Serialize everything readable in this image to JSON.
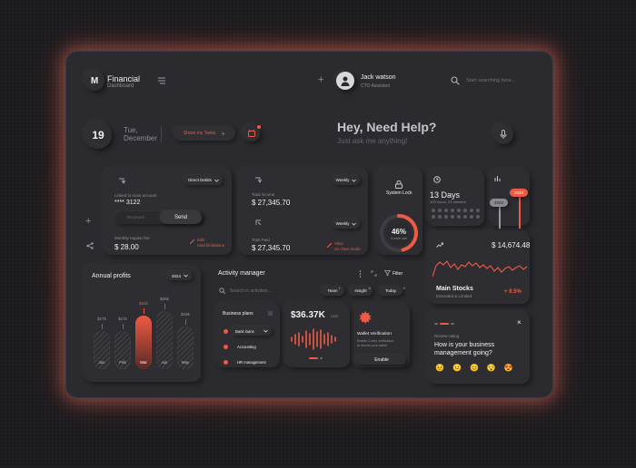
{
  "brand": {
    "title": "Financial",
    "subtitle": "Dashboard",
    "logo_letter": "M"
  },
  "user": {
    "name": "Jack watson",
    "role": "CTO Assistant"
  },
  "search": {
    "placeholder": "Start searching here..."
  },
  "date": {
    "day": "19",
    "weekday": "Tue,",
    "month": "December"
  },
  "share_tasks": {
    "label": "Share my Tasks",
    "plus": "+"
  },
  "help": {
    "title": "Hey, Need Help?",
    "subtitle": "Just ask me anything!"
  },
  "payment": {
    "dropdown": "Direct Debits",
    "linked_label": "Linked to main account",
    "account": "**** 3122",
    "received_label": "Received",
    "send_label": "Send",
    "fee_label": "Monthly regular fee",
    "fee_value": "$ 28.00",
    "edit_label_1": "Edit",
    "edit_label_2": "card limitations"
  },
  "income": {
    "dropdown": "Weekly",
    "total_income_label": "Total income",
    "total_income_value": "$ 27,345.70",
    "dropdown2": "Weekly",
    "total_paid_label": "Total Paid",
    "total_paid_value": "$ 27,345.70",
    "view_label_1": "View",
    "view_label_2": "on chart mode"
  },
  "system_lock": {
    "label": "System Lock",
    "percent": "46%",
    "caption": "Growth rate",
    "progress": 0.46
  },
  "days": {
    "title": "13 Days",
    "subtitle": "109 hours, 23 minutes"
  },
  "years": {
    "a": "2023",
    "b": "2024"
  },
  "stocks": {
    "value": "$ 14,674.48",
    "title": "Main Stocks",
    "subtitle": "Extended & Limited",
    "change": "+ 9.5%"
  },
  "annual_profits": {
    "title": "Annual profits",
    "year": "2024",
    "bars": [
      {
        "month": "Jan",
        "label": "$17k",
        "value": 17
      },
      {
        "month": "Feb",
        "label": "$17k",
        "value": 17
      },
      {
        "month": "Mar",
        "label": "$24k",
        "value": 24
      },
      {
        "month": "Apr",
        "label": "$26k",
        "value": 26
      },
      {
        "month": "May",
        "label": "$19k",
        "value": 19
      }
    ]
  },
  "activity": {
    "title": "Activity manager",
    "filter_label": "Filter",
    "search_placeholder": "Search in activities...",
    "chips": [
      "Team",
      "Insight",
      "Today"
    ],
    "business_title": "Business plans",
    "business_items": [
      "Bank loans",
      "Accounting",
      "HR management"
    ],
    "amount": "$36.37K",
    "amount_currency": "USD"
  },
  "wallet": {
    "title": "Wallet Verification",
    "desc_1": "Enable 2-step verification",
    "desc_2": "to secure your wallet",
    "enable_label": "Enable"
  },
  "review": {
    "label": "Review rating",
    "question_1": "How is your business",
    "question_2": "management going?",
    "emojis": [
      "😣",
      "😐",
      "😊",
      "😯",
      "😍"
    ]
  },
  "colors": {
    "accent": "#ef5a44",
    "panel": "#2b2b2f",
    "background": "#1b1b1e"
  }
}
